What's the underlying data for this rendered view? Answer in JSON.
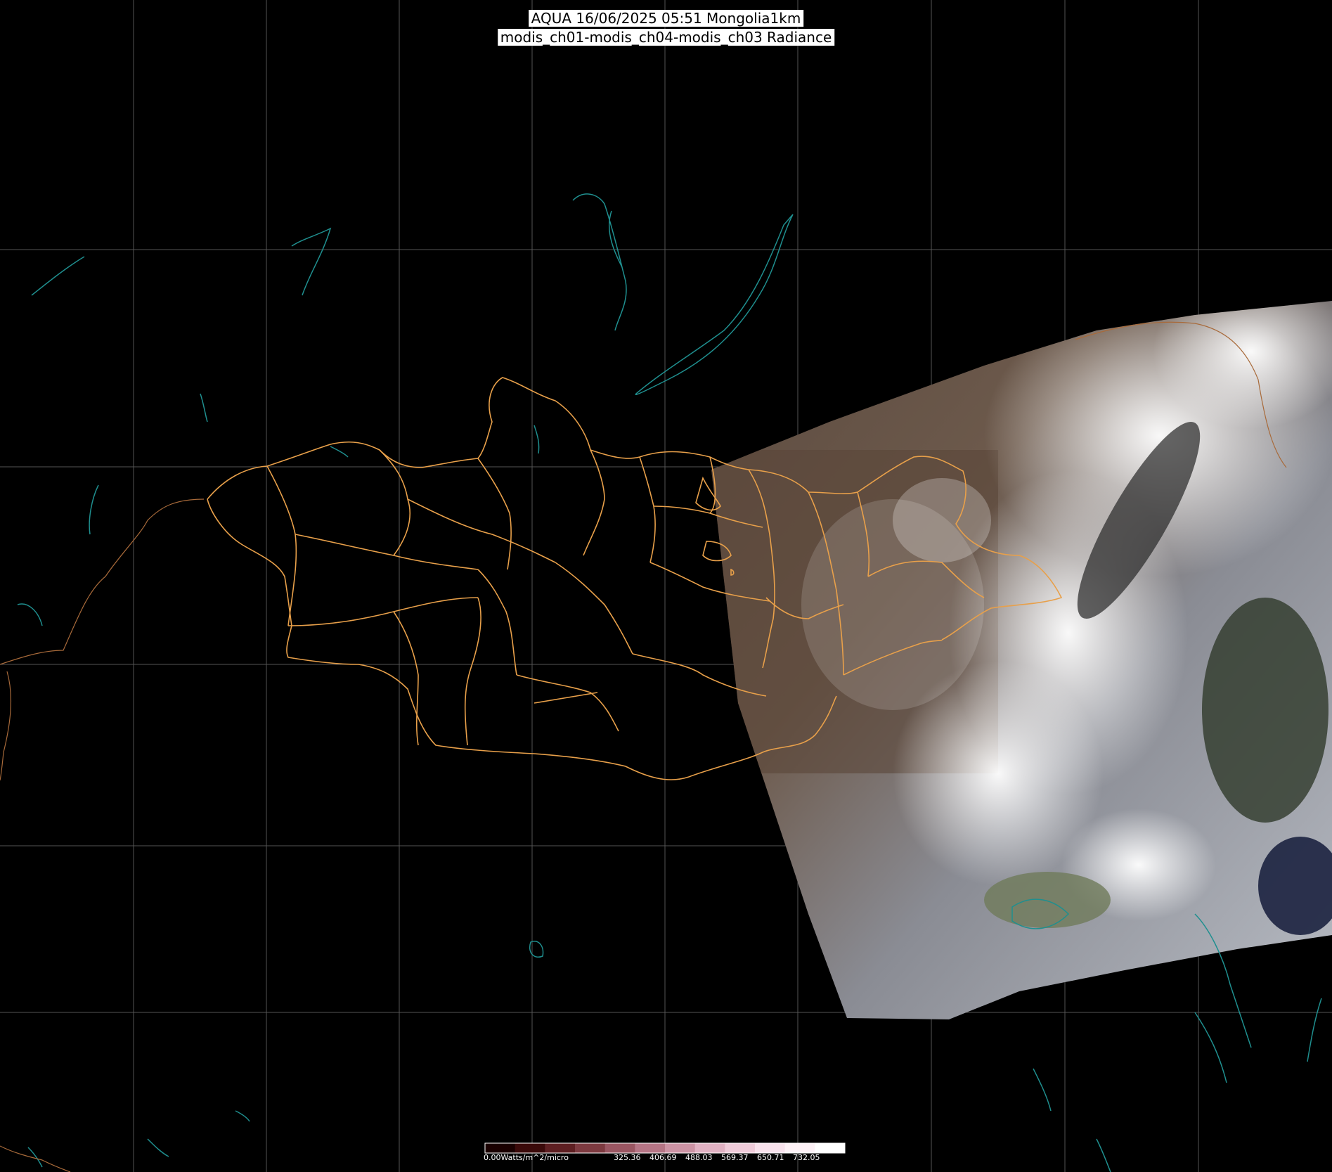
{
  "title": {
    "line1": "AQUA 16/06/2025 05:51 Mongolia1km",
    "line2": "modis_ch01-modis_ch04-modis_ch03 Radiance"
  },
  "colorbar": {
    "unit_label": "0.00Watts/m^2/micro",
    "tick_labels": [
      "325.36",
      "406.69",
      "488.03",
      "569.37",
      "650.71",
      "732.05"
    ],
    "colors": [
      "#1a0000",
      "#3b0a0a",
      "#5e1f22",
      "#7d3a40",
      "#9a5662",
      "#b57585",
      "#cc93a4",
      "#e0b1c2",
      "#efcbd9",
      "#f8e2ec",
      "#fdf1f6",
      "#ffffff"
    ]
  },
  "colors": {
    "background": "#000000",
    "graticule": "#555555",
    "admin_borders": "#e8a04a",
    "water_outlines": "#1f8f8f",
    "country_border": "#a86a3a"
  }
}
